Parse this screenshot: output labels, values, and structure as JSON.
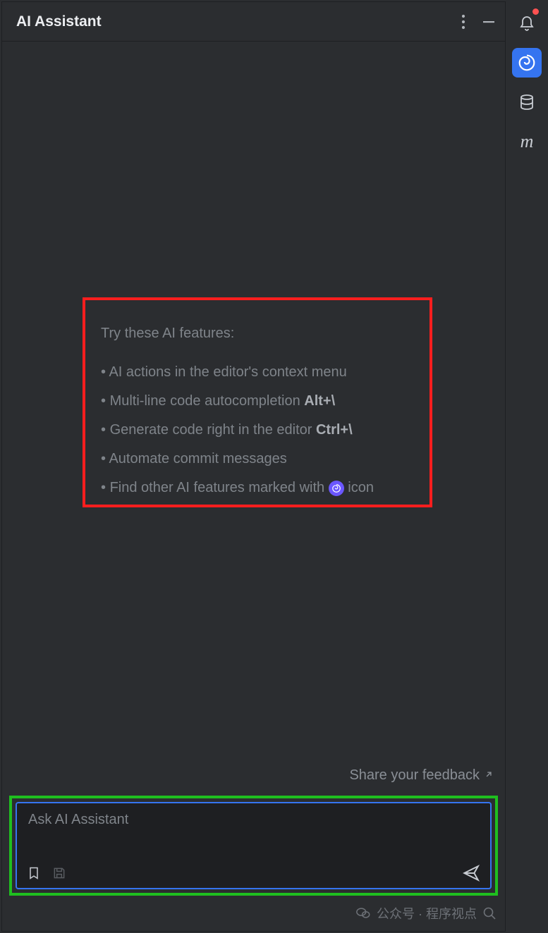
{
  "header": {
    "title": "AI Assistant",
    "icons": {
      "more": "more-vert-icon",
      "minimize": "minimize-icon"
    }
  },
  "tips": {
    "title": "Try these AI features:",
    "items": [
      {
        "text": "AI actions in the editor's context menu",
        "shortcut": ""
      },
      {
        "text": "Multi-line code autocompletion ",
        "shortcut": "Alt+\\"
      },
      {
        "text": "Generate code right in the editor ",
        "shortcut": "Ctrl+\\"
      },
      {
        "text": "Automate commit messages",
        "shortcut": ""
      },
      {
        "text_prefix": "Find other AI features marked with ",
        "text_suffix": " icon",
        "has_icon": true
      }
    ]
  },
  "feedback": {
    "label": "Share your feedback"
  },
  "input": {
    "placeholder": "Ask AI Assistant",
    "icons": {
      "bookmark": "bookmark-icon",
      "save": "save-icon",
      "send": "send-icon"
    }
  },
  "sidebar": {
    "items": [
      {
        "name": "notifications-bell",
        "active": false,
        "has_badge": true
      },
      {
        "name": "ai-assistant-spiral",
        "active": true
      },
      {
        "name": "database",
        "active": false
      },
      {
        "name": "maven-m",
        "active": false
      }
    ]
  },
  "watermark": {
    "text": "公众号 · 程序视点"
  }
}
